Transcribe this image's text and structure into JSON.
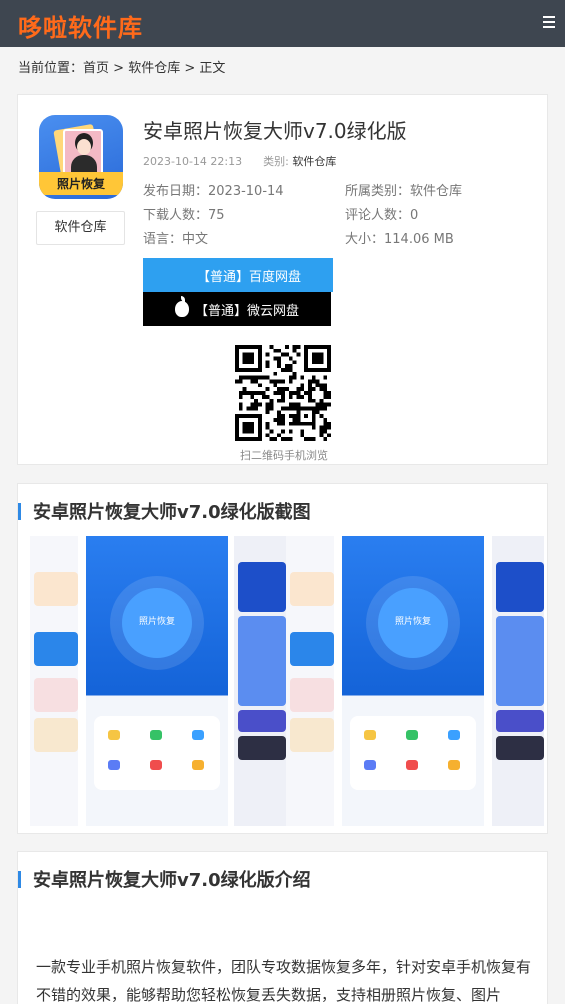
{
  "site": {
    "logo": "哆啦软件库"
  },
  "breadcrumb": {
    "prefix": "当前位置：",
    "home": "首页",
    "sep1": " > ",
    "category": "软件仓库",
    "sep2": " > ",
    "current": "正文"
  },
  "app": {
    "icon_label": "照片恢复",
    "category_box": "软件仓库",
    "title": "安卓照片恢复大师v7.0绿化版",
    "meta_date": "2023-10-14 22:13",
    "meta_cat_label": "类别:",
    "meta_cat": "软件仓库",
    "publish_label": "发布日期：",
    "publish_date": "2023-10-14",
    "category_label": "所属类别：",
    "category": "软件仓库",
    "downloads_label": "下载人数：",
    "downloads": "75",
    "comments_label": "评论人数：",
    "comments": "0",
    "lang_label": "语言：",
    "lang": "中文",
    "size_label": "大小：",
    "size": "114.06 MB",
    "btn_baidu": "【普通】百度网盘",
    "btn_weiyun": "【普通】微云网盘",
    "qr_label": "扫二维码手机浏览"
  },
  "screenshots": {
    "title": "安卓照片恢复大师v7.0绿化版截图",
    "phone_center_label": "照片恢复"
  },
  "intro": {
    "title": "安卓照片恢复大师v7.0绿化版介绍",
    "text": "一款专业手机照片恢复软件，团队专攻数据恢复多年，针对安卓手机恢复有不错的效果，能够帮助您轻松恢复丢失数据，支持相册照片恢复、图片"
  },
  "colors": {
    "header_bg": "#3e4650",
    "logo": "#ff6a1a",
    "accent": "#2e89e5",
    "baidu_btn": "#2ea0f0",
    "weiyun_btn": "#000000"
  },
  "icons": [
    "menu-icon",
    "windows-icon",
    "apple-icon",
    "qr-code"
  ]
}
